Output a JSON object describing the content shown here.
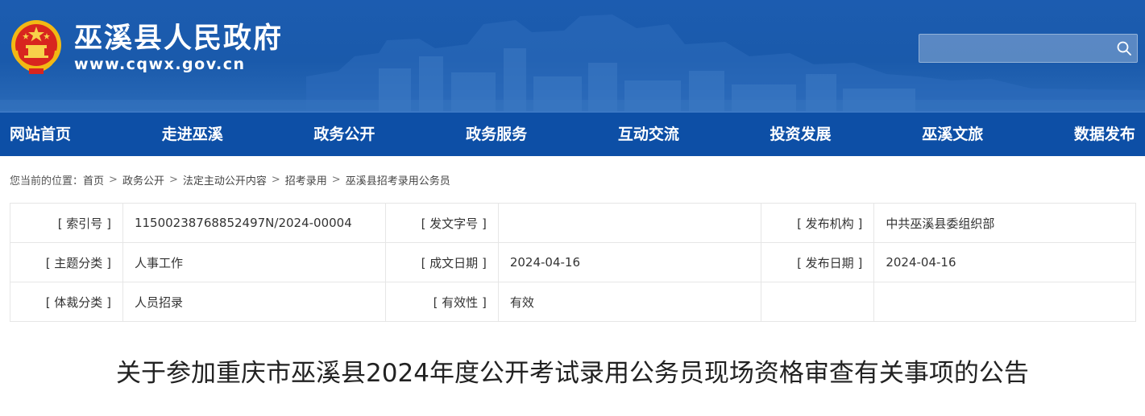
{
  "header": {
    "site_title": "巫溪县人民政府",
    "site_url": "www.cqwx.gov.cn",
    "search": {
      "placeholder": "",
      "value": ""
    },
    "brand_color": "#1a5aab"
  },
  "nav": {
    "bg_color": "#0d4fa6",
    "items": [
      "网站首页",
      "走进巫溪",
      "政务公开",
      "政务服务",
      "互动交流",
      "投资发展",
      "巫溪文旅",
      "数据发布"
    ]
  },
  "breadcrumb": {
    "prefix": "您当前的位置：",
    "items": [
      "首页",
      "政务公开",
      "法定主动公开内容",
      "招考录用",
      "巫溪县招考录用公务员"
    ],
    "separator": ">"
  },
  "meta": {
    "rows": [
      [
        {
          "label": "[ 索引号 ]",
          "value": "11500238768852497N/2024-00004"
        },
        {
          "label": "[ 发文字号 ]",
          "value": ""
        },
        {
          "label": "[ 发布机构 ]",
          "value": "中共巫溪县委组织部"
        }
      ],
      [
        {
          "label": "[ 主题分类 ]",
          "value": "人事工作"
        },
        {
          "label": "[ 成文日期 ]",
          "value": "2024-04-16"
        },
        {
          "label": "[ 发布日期 ]",
          "value": "2024-04-16"
        }
      ],
      [
        {
          "label": "[ 体裁分类 ]",
          "value": "人员招录"
        },
        {
          "label": "[ 有效性 ]",
          "value": "有效"
        },
        {
          "label": "",
          "value": ""
        }
      ]
    ]
  },
  "article": {
    "title": "关于参加重庆市巫溪县2024年度公开考试录用公务员现场资格审查有关事项的公告"
  }
}
